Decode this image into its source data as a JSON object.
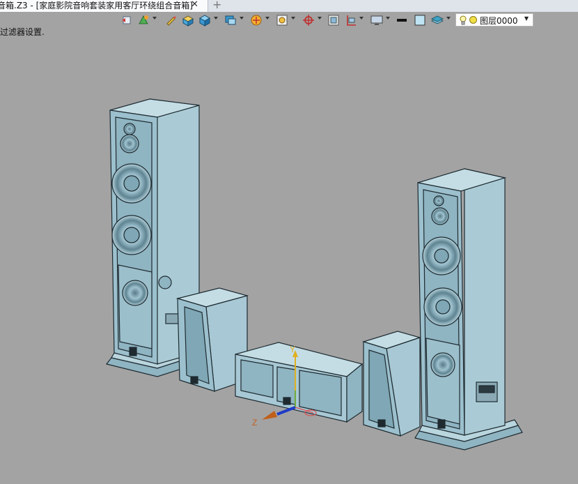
{
  "window": {
    "tab_title": "音箱.Z3 - [家庭影院音响套装家用客厅环绕组合音箱]",
    "close_glyph": "✕",
    "new_tab_glyph": "+"
  },
  "status": {
    "hint": "过滤器设置."
  },
  "toolbar": {
    "layer_selector": {
      "value": "图层0000",
      "arrow": "▼"
    }
  },
  "viewport": {
    "axis_y_label": "Y",
    "axis_z_label": "Z",
    "colors": {
      "background": "#a3a3a3",
      "model_face": "#a7c8d4",
      "model_dark": "#7fa7b5",
      "edge": "#1e2a30",
      "axis_y": "#e0b020",
      "axis_z": "#1e3cc8",
      "axis_x": "#d95050"
    }
  }
}
